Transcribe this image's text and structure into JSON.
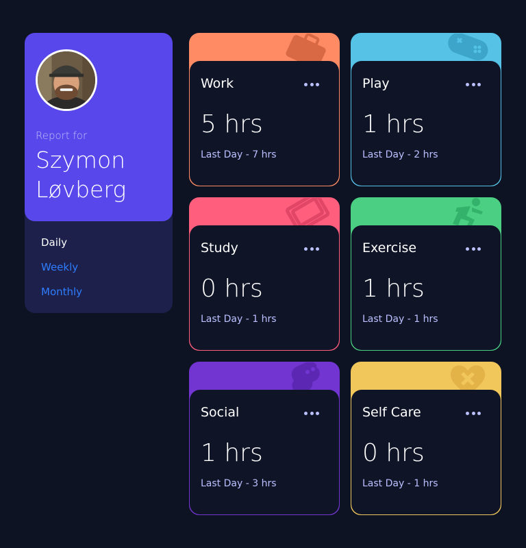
{
  "profile": {
    "report_for": "Report for",
    "name": "Szymon Løvberg",
    "periods": [
      {
        "label": "Daily",
        "state": "active"
      },
      {
        "label": "Weekly",
        "state": "link"
      },
      {
        "label": "Monthly",
        "state": "link"
      }
    ]
  },
  "cards": [
    {
      "title": "Work",
      "hours": "5 hrs",
      "previous": "Last Day - 7 hrs",
      "color": "#ff8b64",
      "icon": "briefcase-icon"
    },
    {
      "title": "Play",
      "hours": "1 hrs",
      "previous": "Last Day - 2 hrs",
      "color": "#55c2e6",
      "icon": "gamepad-icon"
    },
    {
      "title": "Study",
      "hours": "0 hrs",
      "previous": "Last Day - 1 hrs",
      "color": "#ff5e7d",
      "icon": "book-icon"
    },
    {
      "title": "Exercise",
      "hours": "1 hrs",
      "previous": "Last Day - 1 hrs",
      "color": "#4bcf82",
      "icon": "runner-icon"
    },
    {
      "title": "Social",
      "hours": "1 hrs",
      "previous": "Last Day - 3 hrs",
      "color": "#7335d2",
      "icon": "chat-bubble-icon"
    },
    {
      "title": "Self Care",
      "hours": "0 hrs",
      "previous": "Last Day - 1 hrs",
      "color": "#f1c75b",
      "icon": "heart-icon"
    }
  ]
}
